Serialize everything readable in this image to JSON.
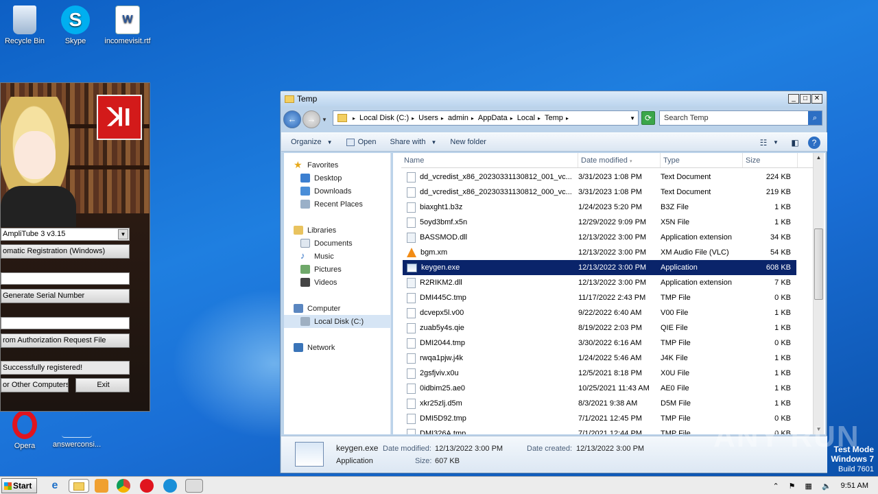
{
  "desktop": {
    "icons": [
      {
        "label": "Recycle Bin",
        "icon": "recycle-bin-icon"
      },
      {
        "label": "Skype",
        "icon": "skype-icon"
      },
      {
        "label": "incomevisit.rtf",
        "icon": "word-doc-icon"
      },
      {
        "label": "Opera",
        "icon": "opera-icon"
      },
      {
        "label": "answerconsi...",
        "icon": "file-icon"
      }
    ],
    "watermark": "ANY RUN",
    "testmode": {
      "line1": "Test Mode",
      "line2": "Windows 7",
      "line3": "Build 7601"
    }
  },
  "keygen": {
    "logo_text": "ꓘI",
    "product_select": "AmpliTube 3 v3.15",
    "method_button": "omatic Registration (Windows)",
    "generate_button": "Generate Serial Number",
    "auth_button": "rom Authorization Request File",
    "status": "Successfully registered!",
    "other_button": "or Other Computers",
    "exit_button": "Exit"
  },
  "explorer": {
    "title": "Temp",
    "breadcrumb": [
      "Local Disk (C:)",
      "Users",
      "admin",
      "AppData",
      "Local",
      "Temp"
    ],
    "search_placeholder": "Search Temp",
    "toolbar": {
      "organize": "Organize",
      "open": "Open",
      "share": "Share with",
      "new_folder": "New folder"
    },
    "nav": {
      "favorites": "Favorites",
      "desktop": "Desktop",
      "downloads": "Downloads",
      "recent": "Recent Places",
      "libraries": "Libraries",
      "documents": "Documents",
      "music": "Music",
      "pictures": "Pictures",
      "videos": "Videos",
      "computer": "Computer",
      "local_disk": "Local Disk (C:)",
      "network": "Network"
    },
    "columns": {
      "name": "Name",
      "date": "Date modified",
      "type": "Type",
      "size": "Size"
    },
    "files": [
      {
        "name": "dd_vcredist_x86_20230331130812_001_vc...",
        "date": "3/31/2023 1:08 PM",
        "type": "Text Document",
        "size": "224 KB",
        "icon": "txt"
      },
      {
        "name": "dd_vcredist_x86_20230331130812_000_vc...",
        "date": "3/31/2023 1:08 PM",
        "type": "Text Document",
        "size": "219 KB",
        "icon": "txt"
      },
      {
        "name": "biaxght1.b3z",
        "date": "1/24/2023 5:20 PM",
        "type": "B3Z File",
        "size": "1 KB",
        "icon": "file"
      },
      {
        "name": "5oyd3bmf.x5n",
        "date": "12/29/2022 9:09 PM",
        "type": "X5N File",
        "size": "1 KB",
        "icon": "file"
      },
      {
        "name": "BASSMOD.dll",
        "date": "12/13/2022 3:00 PM",
        "type": "Application extension",
        "size": "34 KB",
        "icon": "dll"
      },
      {
        "name": "bgm.xm",
        "date": "12/13/2022 3:00 PM",
        "type": "XM Audio File (VLC)",
        "size": "54 KB",
        "icon": "vlc"
      },
      {
        "name": "keygen.exe",
        "date": "12/13/2022 3:00 PM",
        "type": "Application",
        "size": "608 KB",
        "icon": "exe"
      },
      {
        "name": "R2RIKM2.dll",
        "date": "12/13/2022 3:00 PM",
        "type": "Application extension",
        "size": "7 KB",
        "icon": "dll"
      },
      {
        "name": "DMI445C.tmp",
        "date": "11/17/2022 2:43 PM",
        "type": "TMP File",
        "size": "0 KB",
        "icon": "file"
      },
      {
        "name": "dcvepx5l.v00",
        "date": "9/22/2022 6:40 AM",
        "type": "V00 File",
        "size": "1 KB",
        "icon": "file"
      },
      {
        "name": "zuab5y4s.qie",
        "date": "8/19/2022 2:03 PM",
        "type": "QIE File",
        "size": "1 KB",
        "icon": "file"
      },
      {
        "name": "DMI2044.tmp",
        "date": "3/30/2022 6:16 AM",
        "type": "TMP File",
        "size": "0 KB",
        "icon": "file"
      },
      {
        "name": "rwqa1pjw.j4k",
        "date": "1/24/2022 5:46 AM",
        "type": "J4K File",
        "size": "1 KB",
        "icon": "file"
      },
      {
        "name": "2gsfjviv.x0u",
        "date": "12/5/2021 8:18 PM",
        "type": "X0U File",
        "size": "1 KB",
        "icon": "file"
      },
      {
        "name": "0idbim25.ae0",
        "date": "10/25/2021 11:43 AM",
        "type": "AE0 File",
        "size": "1 KB",
        "icon": "file"
      },
      {
        "name": "xkr25zlj.d5m",
        "date": "8/3/2021 9:38 AM",
        "type": "D5M File",
        "size": "1 KB",
        "icon": "file"
      },
      {
        "name": "DMI5D92.tmp",
        "date": "7/1/2021 12:45 PM",
        "type": "TMP File",
        "size": "0 KB",
        "icon": "file"
      },
      {
        "name": "DMI326A.tmp",
        "date": "7/1/2021 12:44 PM",
        "type": "TMP File",
        "size": "0 KB",
        "icon": "file"
      }
    ],
    "selected_index": 6,
    "details": {
      "name": "keygen.exe",
      "type": "Application",
      "modified_label": "Date modified:",
      "modified": "12/13/2022 3:00 PM",
      "size_label": "Size:",
      "size": "607 KB",
      "created_label": "Date created:",
      "created": "12/13/2022 3:00 PM"
    }
  },
  "taskbar": {
    "start": "Start",
    "clock": "9:51 AM"
  }
}
